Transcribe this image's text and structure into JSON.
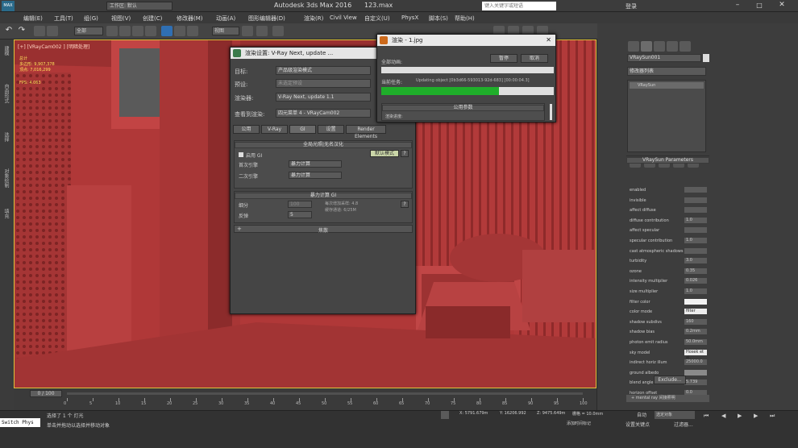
{
  "titlebar": {
    "workspace_label": "工作区: 默认",
    "app_title": "Autodesk 3ds Max 2016",
    "file_name": "123.max",
    "search_placeholder": "键入关键字或短语",
    "login": "登录"
  },
  "menu": [
    "编辑(E)",
    "工具(T)",
    "组(G)",
    "视图(V)",
    "创建(C)",
    "修改器(M)",
    "动画(A)",
    "图形编辑器(D)",
    "渲染(R)",
    "Civil View",
    "自定义(U)",
    "PhysX",
    "脚本(S)",
    "帮助(H)"
  ],
  "toolbar": {
    "filter": "全部",
    "view": "视图"
  },
  "left_tabs": [
    "建模",
    "自由形式",
    "选择",
    "对象绘制",
    "填充"
  ],
  "viewport": {
    "label": "[+] [VRayCam002 ] [明暗处理]",
    "stats": [
      "总计",
      "多边形: 9,907,378",
      "顶点: 7,016,299"
    ],
    "fps_label": "FPS:",
    "fps_value": "4.063"
  },
  "render_setup": {
    "title": "渲染设置: V-Ray Next, update ...",
    "target_label": "目标:",
    "target_value": "产品级渲染模式",
    "preset_label": "预设:",
    "preset_value": "未选定预设",
    "renderer_label": "渲染器:",
    "renderer_value": "V-Ray Next, update 1.1",
    "view_label": "查看到渲染:",
    "view_value": "四元菜单 4 - VRayCam002",
    "tabs": [
      "公用",
      "V-Ray",
      "GI",
      "设置",
      "Render Elements"
    ],
    "gi_section": "全局光照|无名汉化",
    "enable_gi": "启用 GI",
    "default_mode": "默认模式",
    "primary_label": "首次引擎",
    "primary_value": "暴力计算",
    "secondary_label": "二次引擎",
    "secondary_value": "暴力计算",
    "bf_section": "暴力计算 GI",
    "subdivs_label": "细分",
    "subdivs_value": "100",
    "bounces_label": "反弹",
    "bounces_value": "5",
    "samples_text": "每次增加采样: 4.8",
    "buffer_text": "缓存通道: 6/25M",
    "caustics": "焦散"
  },
  "render_progress": {
    "title": "渲染 - 1.jpg",
    "pause": "暂停",
    "cancel": "取消",
    "total_label": "全部动画:",
    "current_label": "当前任务:",
    "current_task": "Updating object [0b3d66-593013-92d-683] [00:00:04.3]",
    "progress": 0.68,
    "section": "公用参数",
    "rendering_label": "渲染进度:"
  },
  "right_panel": {
    "object_name": "VRaySun001",
    "modifier_list": "修改器列表",
    "stack_item": "VRaySun",
    "rollout_title": "VRaySun Parameters",
    "params": [
      {
        "label": "enabled",
        "value": ""
      },
      {
        "label": "invisible",
        "value": ""
      },
      {
        "label": "affect diffuse",
        "value": ""
      },
      {
        "label": "diffuse contribution",
        "value": "1.0"
      },
      {
        "label": "affect specular",
        "value": ""
      },
      {
        "label": "specular contribution",
        "value": "1.0"
      },
      {
        "label": "cast atmospheric shadows",
        "value": ""
      },
      {
        "label": "turbidity",
        "value": "3.0"
      },
      {
        "label": "ozone",
        "value": "0.35"
      },
      {
        "label": "intensity multiplier",
        "value": "0.026"
      },
      {
        "label": "size multiplier",
        "value": "1.0"
      },
      {
        "label": "filter color",
        "value": ""
      },
      {
        "label": "color mode",
        "value": "filter"
      },
      {
        "label": "shadow subdivs",
        "value": "160"
      },
      {
        "label": "shadow bias",
        "value": "0.2mm"
      },
      {
        "label": "photon emit radius",
        "value": "50.0mm"
      },
      {
        "label": "sky model",
        "value": "Hosek et al."
      },
      {
        "label": "indirect horiz illum",
        "value": "25000.0"
      },
      {
        "label": "ground albedo",
        "value": ""
      },
      {
        "label": "blend angle",
        "value": "5.739"
      },
      {
        "label": "horizon offset",
        "value": "0.0"
      }
    ],
    "exclude": "Exclude...",
    "mental_ray": "mental ray 间接照明"
  },
  "timeline": {
    "frame": "0 / 100",
    "ticks": [
      "0",
      "5",
      "10",
      "15",
      "20",
      "25",
      "30",
      "35",
      "40",
      "45",
      "50",
      "55",
      "60",
      "65",
      "70",
      "75",
      "80",
      "85",
      "90",
      "95",
      "100"
    ]
  },
  "statusbar": {
    "script": "Switch Phys",
    "selected": "选择了 1 个 灯光",
    "hint": "单击并拖动以选择并移动对象",
    "x": "X: 5791.679m",
    "y": "Y: 16206.992",
    "z": "Z: 9475.649m",
    "grid": "栅格 = 10.0mm",
    "add_time_tag": "添加时间标记",
    "auto": "自动",
    "set_key": "设置关键点",
    "selected_obj": "选定对象",
    "filter": "过滤器..."
  },
  "colors": {
    "viewport_red": "#b03838",
    "progress_green": "#1fae2a",
    "accent_yellow": "#e0c23a"
  }
}
